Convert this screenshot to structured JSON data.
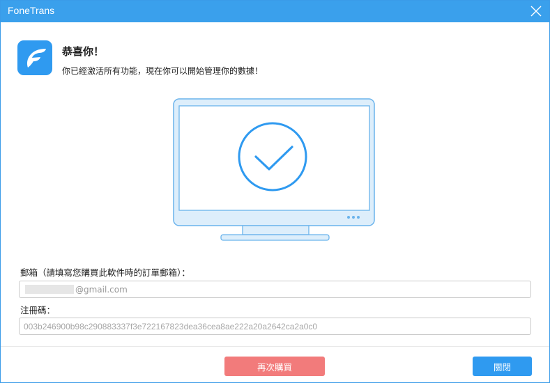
{
  "window": {
    "title": "FoneTrans"
  },
  "header": {
    "heading": "恭喜你！",
    "message": "你已經激活所有功能，現在你可以開始管理你的數據！"
  },
  "form": {
    "email_label": "郵箱（請填寫您購買此軟件時的訂單郵箱）：",
    "email_value": "@gmail.com",
    "code_label": "注冊碼：",
    "code_value": "003b246900b98c290883337f3e722167823dea36cea8ae222a20a2642ca2a0c0"
  },
  "buttons": {
    "buy_again": "再次購買",
    "close": "關閉"
  },
  "colors": {
    "accent": "#3aa0ec",
    "buy_button": "#f27b7b",
    "close_button": "#2f9af0"
  },
  "icons": {
    "app": "fonetrans-logo-icon",
    "close": "close-icon",
    "success": "monitor-check-icon"
  }
}
